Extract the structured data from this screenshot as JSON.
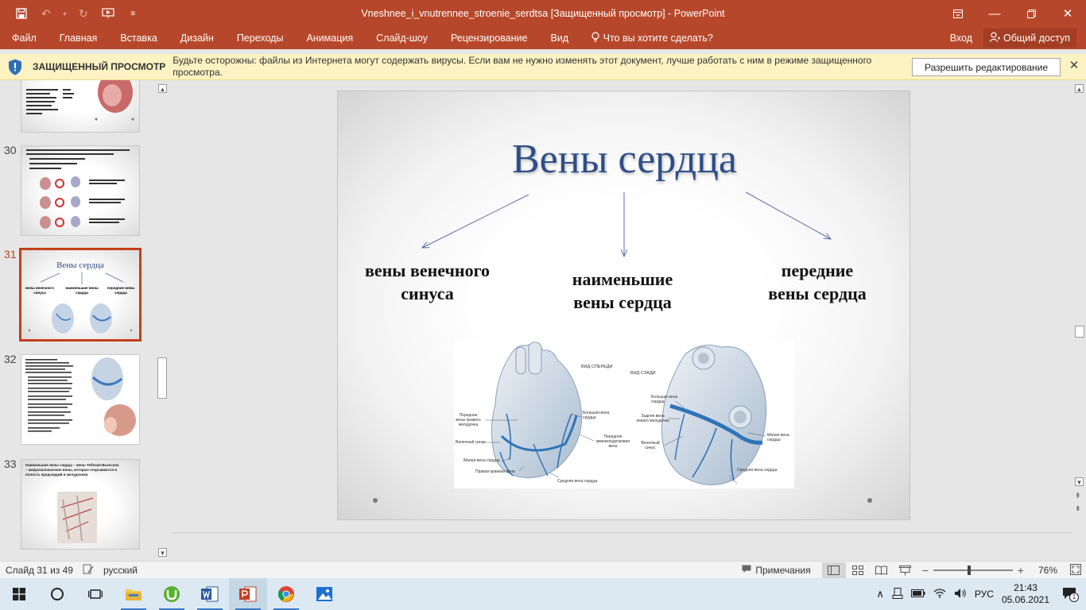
{
  "titlebar": {
    "title": "Vneshnee_i_vnutrennee_stroenie_serdtsa [Защищенный просмотр] - PowerPoint",
    "bg_color": "#b7472a"
  },
  "ribbon": {
    "tabs": [
      "Файл",
      "Главная",
      "Вставка",
      "Дизайн",
      "Переходы",
      "Анимация",
      "Слайд-шоу",
      "Рецензирование",
      "Вид"
    ],
    "tell_me": "Что вы хотите сделать?",
    "signin": "Вход",
    "share": "Общий доступ"
  },
  "protected_view": {
    "title": "ЗАЩИЩЕННЫЙ ПРОСМОТР",
    "message": "Будьте осторожны: файлы из Интернета могут содержать вирусы. Если вам не нужно изменять этот документ, лучше работать с ним в режиме защищенного просмотра.",
    "enable_button": "Разрешить редактирование",
    "bg_color": "#fdf2c1"
  },
  "thumbnails": {
    "numbers": [
      "30",
      "31",
      "32",
      "33"
    ],
    "active": "31",
    "thumb31": {
      "title": "Вены сердца",
      "labels": [
        "вены венечного синуса",
        "наименьшие вены сердца",
        "передние вены сердца"
      ]
    },
    "thumb33_text": "Наименьшие вены сердца – вены Тебезия-Вьессена – микроскопические вены, которые открываются в полость предсердий и желудочков"
  },
  "slide": {
    "title": "Вены сердца",
    "label_left": [
      "вены венечного",
      "синуса"
    ],
    "label_center": [
      "наименьшие",
      "вены сердца"
    ],
    "label_right": [
      "передние",
      "вены сердца"
    ],
    "diagram_labels": {
      "view_front": "ВИД СПЕРЕДИ",
      "view_back": "ВИД СЗАДИ",
      "ant_veins": "Передние вены правого желудочка",
      "coronary_sinus": "Венечный синус",
      "small_vein": "Малая вена сердца",
      "right_marginal": "Правая краевая вена",
      "great_vein": "Большая вена сердца",
      "ant_interventricular": "Передняя межжелудочковая вена",
      "middle_vein": "Средняя вена сердца",
      "great_vein_b": "Большая вена сердца",
      "post_vein": "Задняя вена левого желудочка",
      "coronary_sinus_b": "Венечный синус",
      "small_vein_b": "Малая вена сердца",
      "middle_vein_b": "Средняя вена сердца"
    },
    "title_color": "#2e4e86"
  },
  "statusbar": {
    "slide_info": "Слайд 31 из 49",
    "language": "русский",
    "notes": "Примечания",
    "zoom": "76%"
  },
  "taskbar": {
    "lang": "РУС",
    "time": "21:43",
    "date": "05.06.2021",
    "notification_count": "1"
  }
}
